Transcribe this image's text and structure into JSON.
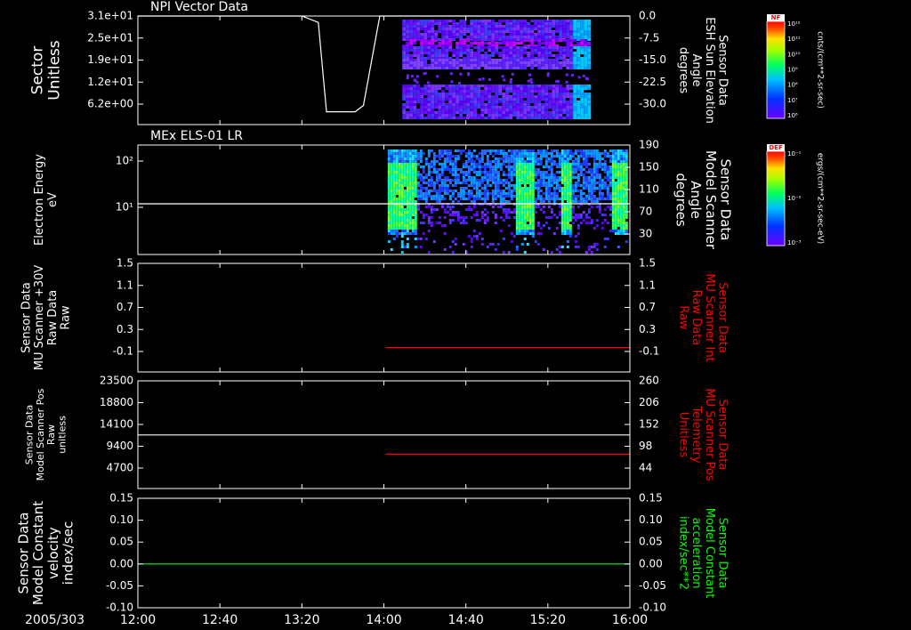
{
  "chart_data": [
    {
      "type": "heatmap",
      "title": "NPI Vector Data",
      "ylabel_left": [
        "Sector",
        "Unitless"
      ],
      "yticks_left": [
        "3.1e+01",
        "2.5e+01",
        "1.9e+01",
        "1.2e+01",
        "6.2e+00"
      ],
      "ylabel_right": [
        "Sensor Data",
        "ESH Sun Elevation",
        "Angle",
        "degrees"
      ],
      "yticks_right": [
        "0.0",
        "-7.5",
        "-15.0",
        "-22.5",
        "-30.0"
      ],
      "ylim_right": [
        -34,
        0
      ],
      "data_start": "14:09",
      "data_end": "15:40",
      "line_series": {
        "color": "#ffffff",
        "x": [
          "12:00",
          "13:20",
          "13:28",
          "13:32",
          "13:46",
          "13:50",
          "13:58",
          "16:00"
        ],
        "y": [
          0.0,
          0.0,
          -2.0,
          -30.0,
          -30.0,
          -28.0,
          0.0,
          0.0
        ]
      },
      "colorbar": {
        "label": "NF",
        "units": "cnts/(cm**2-sr-sec)",
        "ticks": [
          "10¹²",
          "10¹¹",
          "10¹⁰",
          "10⁹",
          "10⁸",
          "10⁷",
          "10⁶"
        ]
      }
    },
    {
      "type": "heatmap",
      "title": "MEx ELS-01 LR",
      "ylabel_left": [
        "Electron Energy",
        "eV"
      ],
      "yticks_left": [
        "10²",
        "10¹"
      ],
      "ylabel_right": [
        "Sensor Data",
        "Model Scanner",
        "Angle",
        "degrees"
      ],
      "yticks_right": [
        "190",
        "150",
        "110",
        "70",
        "30"
      ],
      "ylim_right": [
        0,
        190
      ],
      "data_start": "14:01",
      "data_end": "16:00",
      "line_series": {
        "color": "#ffffff",
        "x": [
          "12:00",
          "16:00"
        ],
        "y": [
          88,
          88
        ]
      },
      "colorbar": {
        "label": "DEF",
        "units": "ergs/(cm**2-sr-sec-eV)",
        "ticks": [
          "10⁻¹",
          "10⁻²",
          "10⁻³"
        ]
      }
    },
    {
      "type": "line",
      "ylabel_left": [
        "Sensor Data",
        "MU Scanner +30V",
        "Raw Data",
        "Raw"
      ],
      "yticks_left": [
        "1.5",
        "1.1",
        "0.7",
        "0.3",
        "-0.1"
      ],
      "ylim_left": [
        -0.5,
        1.5
      ],
      "ylabel_right": [
        "Sensor Data",
        "MU Scanner Int",
        "Raw Data",
        "Raw"
      ],
      "yticks_right": [
        "1.5",
        "1.1",
        "0.7",
        "0.3",
        "-0.1"
      ],
      "ylim_right": [
        -0.5,
        1.5
      ],
      "series": [
        {
          "axis": "right",
          "color": "#ff0000",
          "x": [
            "14:01",
            "16:00"
          ],
          "y": [
            -0.05,
            -0.05
          ]
        }
      ]
    },
    {
      "type": "line",
      "ylabel_left": [
        "Sensor Data",
        "Model Scanner Pos",
        "Raw",
        "unitless"
      ],
      "yticks_left": [
        "23500",
        "18800",
        "14100",
        "9400",
        "4700"
      ],
      "ylim_left": [
        0,
        23500
      ],
      "ylabel_right": [
        "Sensor Data",
        "MU Scanner Pos",
        "Telemetry",
        "Unitless"
      ],
      "yticks_right": [
        "260",
        "206",
        "152",
        "98",
        "44"
      ],
      "ylim_right": [
        0,
        260
      ],
      "series": [
        {
          "axis": "left",
          "color": "#ffffff",
          "x": [
            "12:00",
            "16:00"
          ],
          "y": [
            11700,
            11700
          ]
        },
        {
          "axis": "right",
          "color": "#ff0000",
          "x": [
            "14:01",
            "16:00"
          ],
          "y": [
            83,
            83
          ]
        }
      ]
    },
    {
      "type": "line",
      "ylabel_left": [
        "Sensor Data",
        "Model Constant",
        "velocity",
        "index/sec"
      ],
      "yticks_left": [
        "0.15",
        "0.10",
        "0.05",
        "0.00",
        "-0.05",
        "-0.10"
      ],
      "ylim_left": [
        -0.1,
        0.15
      ],
      "ylabel_right": [
        "Sensor Data",
        "Model Constant",
        "acceleration",
        "index/sec**2"
      ],
      "yticks_right": [
        "0.15",
        "0.10",
        "0.05",
        "0.00",
        "-0.05",
        "-0.10"
      ],
      "ylim_right": [
        -0.1,
        0.15
      ],
      "series": [
        {
          "axis": "left",
          "color": "#00ff00",
          "x": [
            "12:00",
            "16:00"
          ],
          "y": [
            0.0,
            0.0
          ]
        }
      ]
    }
  ],
  "x_axis": {
    "date_label": "2005/303",
    "ticks": [
      "12:00",
      "12:40",
      "13:20",
      "14:00",
      "14:40",
      "15:20",
      "16:00"
    ],
    "xlim": [
      "12:00",
      "16:00"
    ]
  },
  "colors": {
    "background": "#000000",
    "frame": "#ffffff",
    "red_axis": "#ff0000",
    "green_axis": "#00ff00"
  }
}
